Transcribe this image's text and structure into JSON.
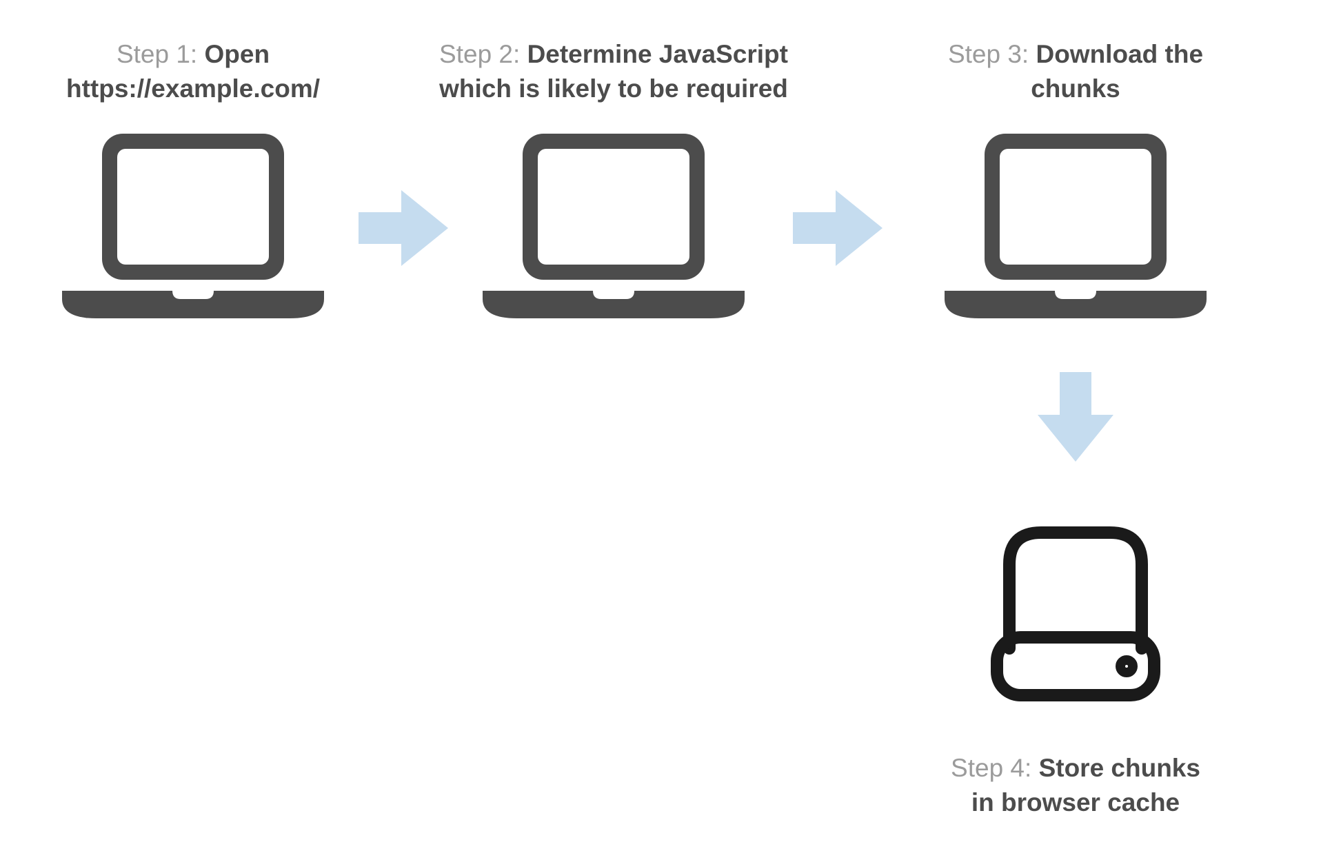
{
  "colors": {
    "laptop": "#4c4c4c",
    "arrow": "#c5dcef",
    "hdd_stroke": "#1a1a1a",
    "text_gray": "#9b9b9b",
    "text_bold": "#4c4c4c"
  },
  "steps": {
    "step1": {
      "prefix": "Step 1: ",
      "bold_a": "Open",
      "bold_b": "https://example.com/"
    },
    "step2": {
      "prefix": "Step 2: ",
      "bold_a": "Determine JavaScript",
      "bold_b": "which is likely to be required"
    },
    "step3": {
      "prefix": "Step 3: ",
      "bold_a": "Download the",
      "bold_b": "chunks"
    },
    "step4": {
      "prefix": "Step 4: ",
      "bold_a": "Store chunks",
      "bold_b": "in browser cache"
    }
  }
}
